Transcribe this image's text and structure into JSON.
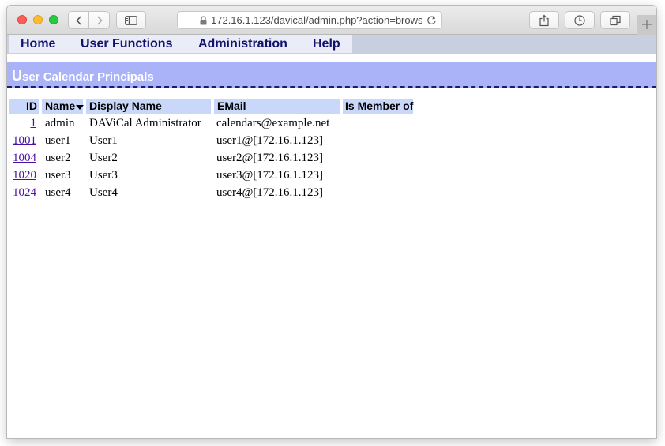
{
  "browser": {
    "url": "172.16.1.123/davical/admin.php?action=brows"
  },
  "menu": {
    "items": [
      "Home",
      "User Functions",
      "Administration",
      "Help"
    ]
  },
  "page": {
    "title_first_letter": "U",
    "title_rest": "ser Calendar Principals"
  },
  "table": {
    "headers": {
      "id": "ID",
      "name": "Name",
      "display_name": "Display Name",
      "email": "EMail",
      "member_of": "Is Member of"
    },
    "sort_column": "name",
    "rows": [
      {
        "id": "1",
        "name": "admin",
        "display_name": "DAViCal Administrator",
        "email": "calendars@example.net",
        "member_of": ""
      },
      {
        "id": "1001",
        "name": "user1",
        "display_name": "User1",
        "email": "user1@[172.16.1.123]",
        "member_of": ""
      },
      {
        "id": "1004",
        "name": "user2",
        "display_name": "User2",
        "email": "user2@[172.16.1.123]",
        "member_of": ""
      },
      {
        "id": "1020",
        "name": "user3",
        "display_name": "User3",
        "email": "user3@[172.16.1.123]",
        "member_of": ""
      },
      {
        "id": "1024",
        "name": "user4",
        "display_name": "User4",
        "email": "user4@[172.16.1.123]",
        "member_of": ""
      }
    ]
  },
  "colors": {
    "menu_text": "#10126e",
    "header_band": "#aab3f8",
    "table_header": "#c9d8fa",
    "link": "#4b10a6"
  }
}
